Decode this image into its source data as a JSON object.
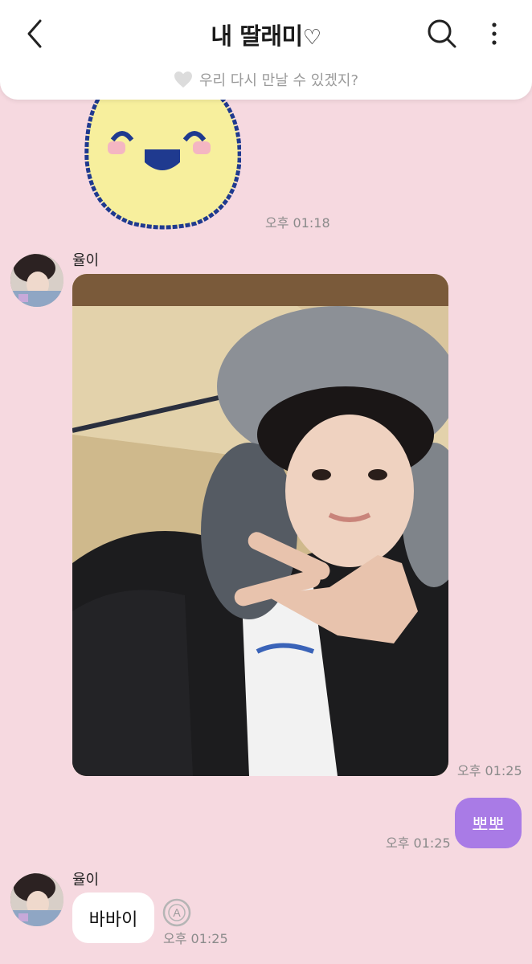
{
  "header": {
    "title": "내 딸래미",
    "title_heart": "♡",
    "subtitle": "우리 다시 만날 수 있겠지?"
  },
  "messages": {
    "sticker_time": "오후 01:18",
    "sender_1": "율이",
    "photo_time": "오후 01:25",
    "mine_text": "뽀뽀",
    "mine_time": "오후 01:25",
    "sender_2": "율이",
    "other_text": "바바이",
    "other_time": "오후 01:25"
  },
  "colors": {
    "background": "#f6d9e0",
    "my_bubble": "#a97be6",
    "other_bubble": "#ffffff"
  },
  "icons": [
    "back-arrow-icon",
    "search-icon",
    "more-vertical-icon",
    "heart-icon",
    "translate-icon"
  ]
}
